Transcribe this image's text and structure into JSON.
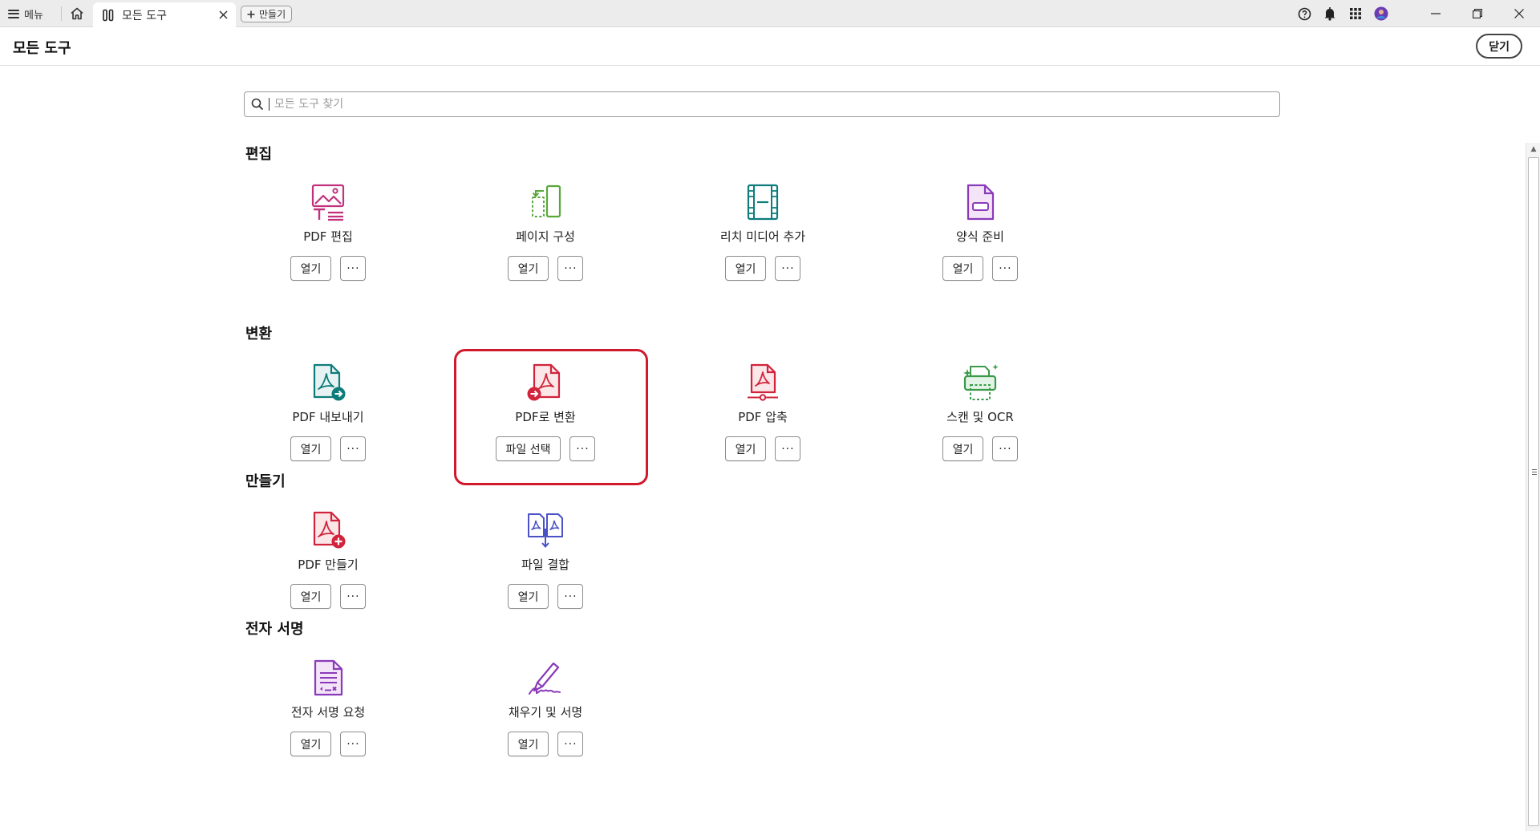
{
  "tabbar": {
    "menu_label": "메뉴",
    "active_tab": "모든 도구",
    "new_button": "만들기"
  },
  "header": {
    "title": "모든 도구",
    "close_label": "닫기"
  },
  "search": {
    "placeholder": "모든 도구 찾기"
  },
  "colors": {
    "highlight": "#d01a2c",
    "pink": "#c0317e",
    "green": "#5aa83c",
    "teal": "#0e7c7b",
    "purple": "#8a3ab9",
    "red": "#d2233c",
    "indigo": "#4b52c7"
  },
  "sections": [
    {
      "title": "편집",
      "tools": [
        {
          "name": "PDF 편집",
          "action": "열기",
          "more": "···",
          "icon": "edit-pdf-icon"
        },
        {
          "name": "페이지 구성",
          "action": "열기",
          "more": "···",
          "icon": "organize-pages-icon"
        },
        {
          "name": "리치 미디어 추가",
          "action": "열기",
          "more": "···",
          "icon": "rich-media-icon"
        },
        {
          "name": "양식 준비",
          "action": "열기",
          "more": "···",
          "icon": "prepare-form-icon"
        }
      ]
    },
    {
      "title": "변환",
      "tools": [
        {
          "name": "PDF 내보내기",
          "action": "열기",
          "more": "···",
          "icon": "export-pdf-icon"
        },
        {
          "name": "PDF로 변환",
          "action": "파일 선택",
          "more": "···",
          "icon": "create-pdf-convert-icon"
        },
        {
          "name": "PDF 압축",
          "action": "열기",
          "more": "···",
          "icon": "compress-pdf-icon"
        },
        {
          "name": "스캔 및 OCR",
          "action": "열기",
          "more": "···",
          "icon": "scan-ocr-icon"
        }
      ]
    },
    {
      "title": "만들기",
      "tools": [
        {
          "name": "PDF 만들기",
          "action": "열기",
          "more": "···",
          "icon": "create-pdf-icon"
        },
        {
          "name": "파일 결합",
          "action": "열기",
          "more": "···",
          "icon": "combine-files-icon"
        }
      ]
    },
    {
      "title": "전자 서명",
      "tools": [
        {
          "name": "전자 서명 요청",
          "action": "열기",
          "more": "···",
          "icon": "request-esign-icon"
        },
        {
          "name": "채우기 및 서명",
          "action": "열기",
          "more": "···",
          "icon": "fill-sign-icon"
        }
      ]
    }
  ]
}
